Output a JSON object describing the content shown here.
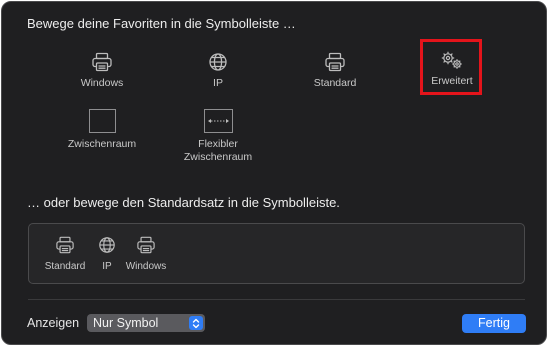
{
  "favorites_heading": "Bewege deine Favoriten in die Symbolleiste …",
  "favorites": [
    {
      "label": "Windows",
      "icon": "printer-icon"
    },
    {
      "label": "IP",
      "icon": "globe-icon"
    },
    {
      "label": "Standard",
      "icon": "printer-icon"
    },
    {
      "label": "Erweitert",
      "icon": "gears-icon"
    },
    {
      "label": "Zwischenraum",
      "icon": "space-icon"
    },
    {
      "label": "Flexibler\nZwischenraum",
      "icon": "flexible-space-icon"
    }
  ],
  "default_set_heading": "… oder bewege den Standardsatz in die Symbolleiste.",
  "default_set": [
    {
      "label": "Standard",
      "icon": "printer-icon"
    },
    {
      "label": "IP",
      "icon": "globe-icon"
    },
    {
      "label": "Windows",
      "icon": "printer-icon"
    }
  ],
  "footer": {
    "show_label": "Anzeigen",
    "show_select_value": "Nur Symbol",
    "done_button": "Fertig"
  },
  "colors": {
    "highlight": "#e4141b",
    "accent": "#2f7df6"
  }
}
